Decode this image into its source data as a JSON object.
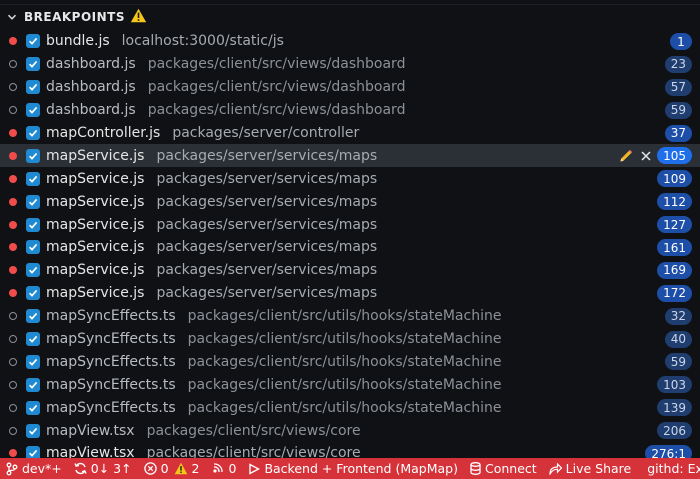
{
  "section": {
    "title": "BREAKPOINTS"
  },
  "breakpoints": [
    {
      "file": "bundle.js",
      "path": "localhost:3000/static/js",
      "line": "1",
      "verified": true,
      "selected": false
    },
    {
      "file": "dashboard.js",
      "path": "packages/client/src/views/dashboard",
      "line": "23",
      "verified": false,
      "selected": false
    },
    {
      "file": "dashboard.js",
      "path": "packages/client/src/views/dashboard",
      "line": "57",
      "verified": false,
      "selected": false
    },
    {
      "file": "dashboard.js",
      "path": "packages/client/src/views/dashboard",
      "line": "59",
      "verified": false,
      "selected": false
    },
    {
      "file": "mapController.js",
      "path": "packages/server/controller",
      "line": "37",
      "verified": true,
      "selected": false
    },
    {
      "file": "mapService.js",
      "path": "packages/server/services/maps",
      "line": "105",
      "verified": true,
      "selected": true
    },
    {
      "file": "mapService.js",
      "path": "packages/server/services/maps",
      "line": "109",
      "verified": true,
      "selected": false
    },
    {
      "file": "mapService.js",
      "path": "packages/server/services/maps",
      "line": "112",
      "verified": true,
      "selected": false
    },
    {
      "file": "mapService.js",
      "path": "packages/server/services/maps",
      "line": "127",
      "verified": true,
      "selected": false
    },
    {
      "file": "mapService.js",
      "path": "packages/server/services/maps",
      "line": "161",
      "verified": true,
      "selected": false
    },
    {
      "file": "mapService.js",
      "path": "packages/server/services/maps",
      "line": "169",
      "verified": true,
      "selected": false
    },
    {
      "file": "mapService.js",
      "path": "packages/server/services/maps",
      "line": "172",
      "verified": true,
      "selected": false
    },
    {
      "file": "mapSyncEffects.ts",
      "path": "packages/client/src/utils/hooks/stateMachine",
      "line": "32",
      "verified": false,
      "selected": false
    },
    {
      "file": "mapSyncEffects.ts",
      "path": "packages/client/src/utils/hooks/stateMachine",
      "line": "40",
      "verified": false,
      "selected": false
    },
    {
      "file": "mapSyncEffects.ts",
      "path": "packages/client/src/utils/hooks/stateMachine",
      "line": "59",
      "verified": false,
      "selected": false
    },
    {
      "file": "mapSyncEffects.ts",
      "path": "packages/client/src/utils/hooks/stateMachine",
      "line": "103",
      "verified": false,
      "selected": false
    },
    {
      "file": "mapSyncEffects.ts",
      "path": "packages/client/src/utils/hooks/stateMachine",
      "line": "139",
      "verified": false,
      "selected": false
    },
    {
      "file": "mapView.tsx",
      "path": "packages/client/src/views/core",
      "line": "206",
      "verified": false,
      "selected": false
    },
    {
      "file": "mapView.tsx",
      "path": "packages/client/src/views/core",
      "line": "276:1",
      "verified": true,
      "selected": false
    }
  ],
  "statusbar": {
    "branch": "dev*+",
    "sync": "0↓ 3↑",
    "errors": "0",
    "warnings": "2",
    "ports": "0",
    "launch": "Backend + Frontend (MapMap)",
    "connect": "Connect",
    "live_share": "Live Share",
    "githd": "githd: Expr"
  },
  "colors": {
    "status_bar": "#d6323a",
    "breakpoint_dot": "#f14c4c",
    "checkbox": "#1f8ad2",
    "badge": "#1e4fa8"
  }
}
